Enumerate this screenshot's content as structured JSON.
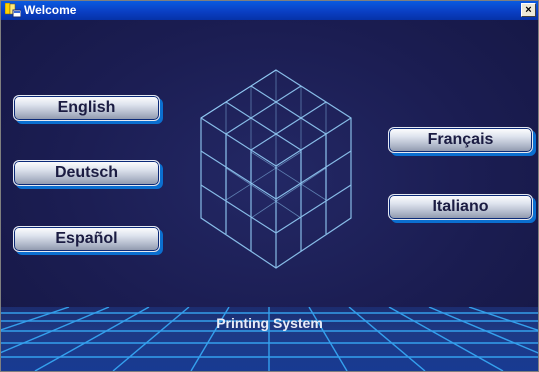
{
  "window": {
    "title": "Welcome",
    "close_glyph": "×",
    "icon": "app-window-icon"
  },
  "languages": {
    "english": "English",
    "deutsch": "Deutsch",
    "espanol": "Español",
    "francais": "Français",
    "italiano": "Italiano"
  },
  "footer": {
    "label": "Printing System"
  },
  "colors": {
    "titlebar": "#0a3fc4",
    "background": "#1b1d4f",
    "button_accent": "#0b6fd0",
    "grid_line": "#9ad6ff"
  }
}
